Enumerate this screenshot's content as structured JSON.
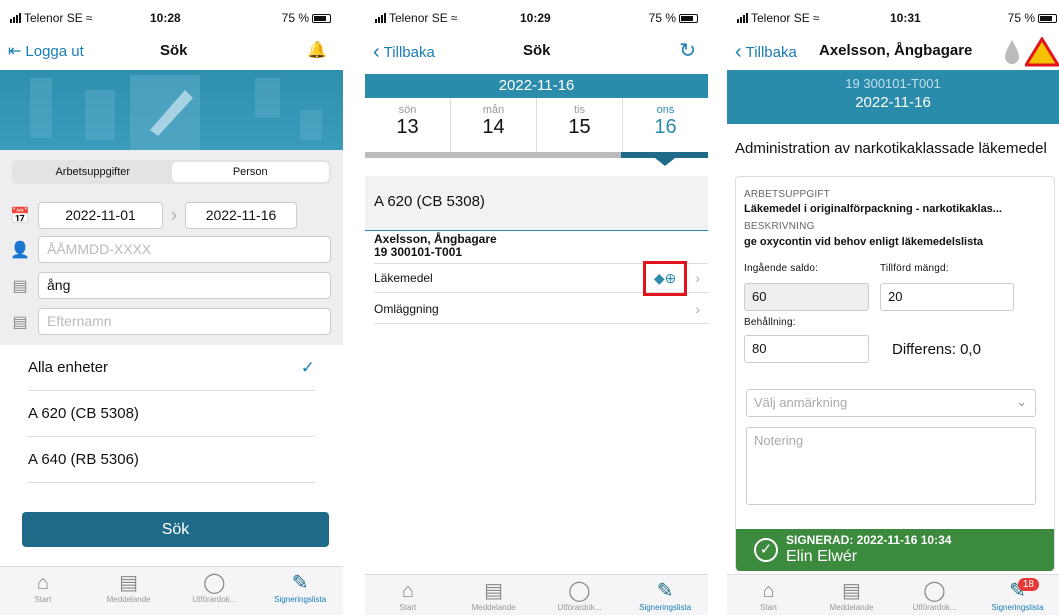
{
  "status": [
    {
      "carrier": "Telenor SE",
      "time": "10:28",
      "battery": "75 %"
    },
    {
      "carrier": "Telenor SE",
      "time": "10:29",
      "battery": "75 %"
    },
    {
      "carrier": "Telenor SE",
      "time": "10:31",
      "battery": "75 %"
    }
  ],
  "p1": {
    "back": "Logga ut",
    "title": "Sök",
    "seg": [
      "Arbetsuppgifter",
      "Person"
    ],
    "date_from": "2022-11-01",
    "date_to": "2022-11-16",
    "pnr_placeholder": "ÅÅMMDD-XXXX",
    "firstname": "ång",
    "lastname_placeholder": "Efternamn",
    "units": [
      {
        "label": "Alla enheter",
        "check": "✓"
      },
      {
        "label": "A 620 (CB 5308)",
        "check": ""
      },
      {
        "label": "A 640 (RB 5306)",
        "check": ""
      }
    ],
    "search_btn": "Sök"
  },
  "p2": {
    "back": "Tillbaka",
    "title": "Sök",
    "date": "2022-11-16",
    "days": [
      {
        "n": "sön",
        "d": "13"
      },
      {
        "n": "mån",
        "d": "14"
      },
      {
        "n": "tis",
        "d": "15"
      },
      {
        "n": "ons",
        "d": "16"
      }
    ],
    "unit": "A 620 (CB 5308)",
    "person_name": "Axelsson, Ångbagare",
    "person_id": "19 300101-T001",
    "rows": [
      "Läkemedel",
      "Omläggning"
    ]
  },
  "p3": {
    "back": "Tillbaka",
    "title": "Axelsson, Ångbagare",
    "pid": "19 300101-T001",
    "date": "2022-11-16",
    "heading": "Administration av narkotikaklassade läkemedel",
    "task_label": "ARBETSUPPGIFT",
    "task": "Läkemedel i originalförpackning - narkotikaklas...",
    "desc_label": "BESKRIVNING",
    "desc": "ge oxycontin vid behov enligt läkemedelslista",
    "in_label": "Ingående saldo:",
    "in_val": "60",
    "add_label": "Tillförd mängd:",
    "add_val": "20",
    "stock_label": "Behållning:",
    "stock_val": "80",
    "diff": "Differens: 0,0",
    "remark_placeholder": "Välj anmärkning",
    "note_placeholder": "Notering",
    "signed": "SIGNERAD: 2022-11-16 10:34",
    "signer": "Elin Elwér"
  },
  "tabs": [
    "Start",
    "Meddelande",
    "Utförardok...",
    "Signeringslista"
  ],
  "badge": "18"
}
